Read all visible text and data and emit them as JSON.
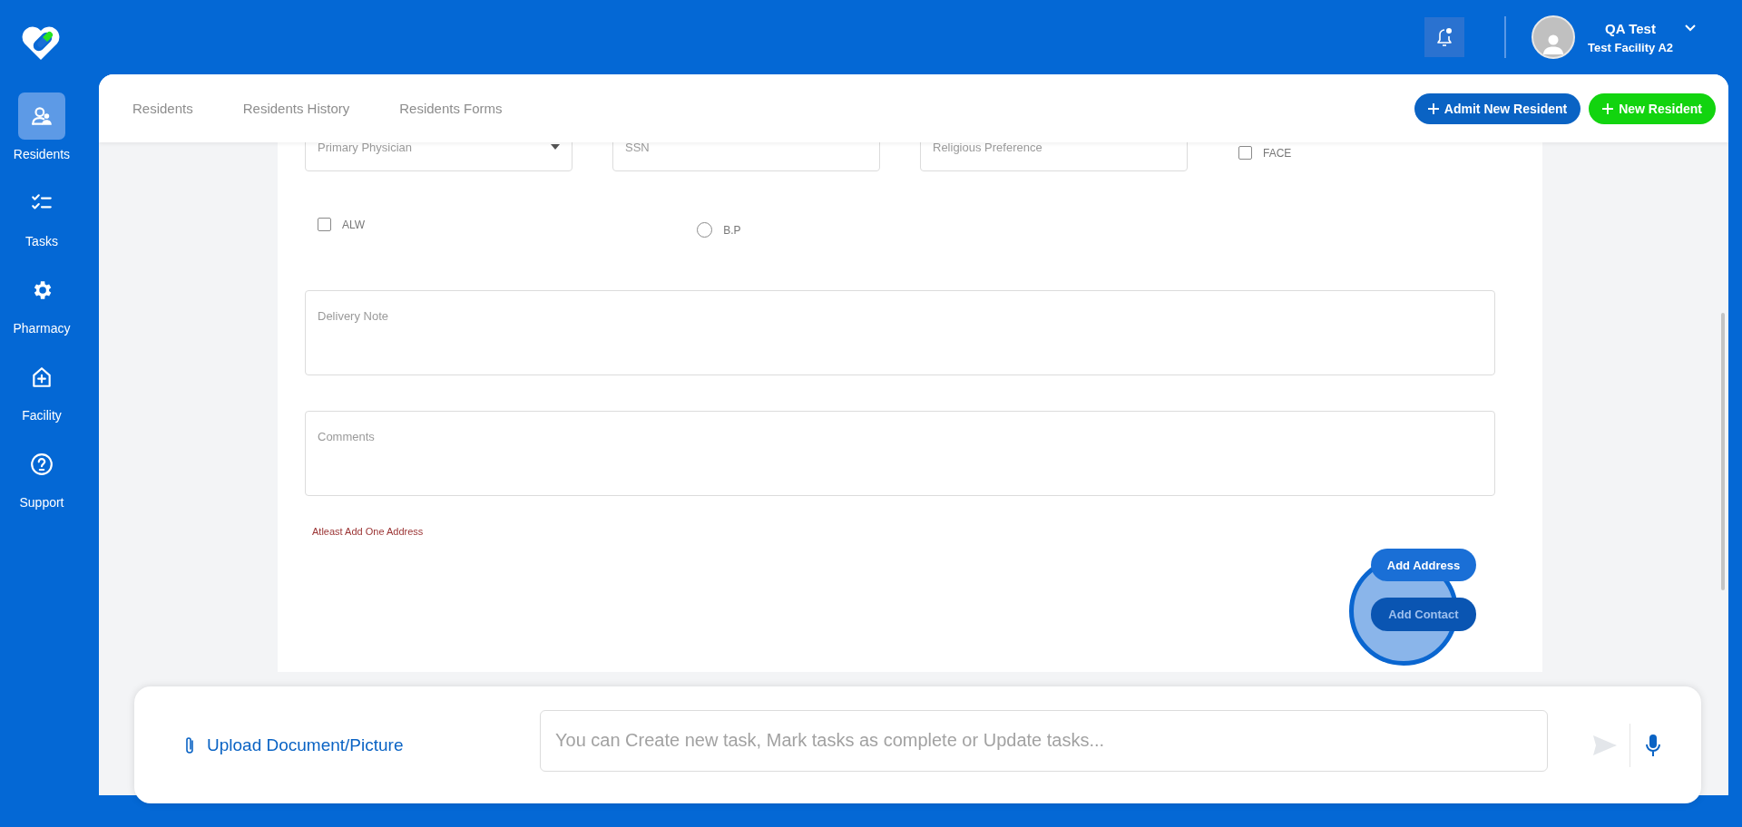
{
  "sidebar": {
    "items": [
      {
        "label": "Residents",
        "kind": "residents",
        "selected": true
      },
      {
        "label": "Tasks",
        "kind": "tasks",
        "selected": false
      },
      {
        "label": "Pharmacy",
        "kind": "pharmacy",
        "selected": false
      },
      {
        "label": "Facility",
        "kind": "facility",
        "selected": false
      },
      {
        "label": "Support",
        "kind": "support",
        "selected": false
      }
    ]
  },
  "user": {
    "name": "QA Test",
    "facility": "Test Facility A2"
  },
  "tabs": [
    {
      "label": "Residents",
      "selected": false
    },
    {
      "label": "Residents History",
      "selected": false
    },
    {
      "label": "Residents Forms",
      "selected": false
    }
  ],
  "actions": [
    {
      "label": "Admit New Resident",
      "kind": "primary"
    },
    {
      "label": "New Resident",
      "kind": "success"
    }
  ],
  "form": {
    "fields": [
      {
        "kind": "select",
        "placeholder": "Primary Physician"
      },
      {
        "kind": "text",
        "placeholder": "SSN"
      },
      {
        "kind": "text",
        "placeholder": "Religious Preference"
      },
      {
        "kind": "checkbox",
        "label": "FACE",
        "checked": false
      }
    ],
    "options": [
      {
        "kind": "checkbox",
        "label": "ALW",
        "checked": false
      },
      {
        "kind": "radio",
        "label": "B.P",
        "checked": false
      }
    ],
    "notes": [
      {
        "placeholder": "Delivery Note"
      },
      {
        "placeholder": "Comments"
      }
    ],
    "error": "Atleast Add One Address",
    "buttons": [
      {
        "label": "Add Address",
        "highlighted": false
      },
      {
        "label": "Add Contact",
        "highlighted": true
      }
    ]
  },
  "composer": {
    "upload": "Upload Document/Picture",
    "placeholder": "You can Create new task, Mark tasks as complete or Update tasks..."
  }
}
